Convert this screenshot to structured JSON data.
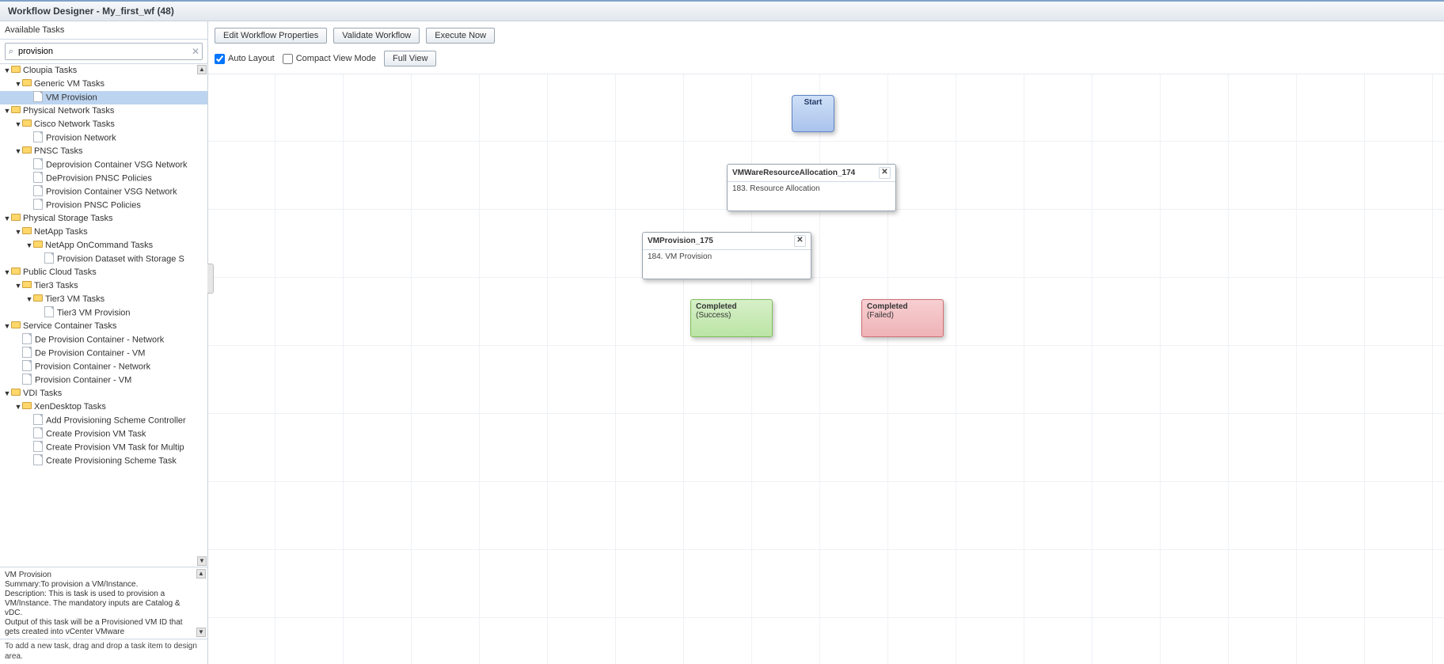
{
  "title": "Workflow Designer - My_first_wf (48)",
  "sidebar": {
    "label": "Available Tasks",
    "search_value": "provision",
    "hint": "To add a new task, drag and drop a task item to design area.",
    "info_title": "VM Provision",
    "info_summary": "Summary:To provision a VM/Instance.",
    "info_desc": "Description: This is task is used to provision a VM/Instance. The mandatory inputs are Catalog & vDC.",
    "info_out": " Output of this task will be a Provisioned VM ID that gets created into vCenter VMware",
    "tree": [
      {
        "indent": 0,
        "type": "folder",
        "label": "Cloupia Tasks"
      },
      {
        "indent": 1,
        "type": "folder",
        "label": "Generic VM Tasks"
      },
      {
        "indent": 2,
        "type": "file",
        "label": "VM Provision",
        "selected": true
      },
      {
        "indent": 0,
        "type": "folder",
        "label": "Physical Network Tasks"
      },
      {
        "indent": 1,
        "type": "folder",
        "label": "Cisco Network Tasks"
      },
      {
        "indent": 2,
        "type": "file",
        "label": "Provision Network"
      },
      {
        "indent": 1,
        "type": "folder",
        "label": "PNSC Tasks"
      },
      {
        "indent": 2,
        "type": "file",
        "label": "Deprovision Container VSG Network"
      },
      {
        "indent": 2,
        "type": "file",
        "label": "DeProvision PNSC Policies"
      },
      {
        "indent": 2,
        "type": "file",
        "label": "Provision Container VSG Network"
      },
      {
        "indent": 2,
        "type": "file",
        "label": "Provision PNSC Policies"
      },
      {
        "indent": 0,
        "type": "folder",
        "label": "Physical Storage Tasks"
      },
      {
        "indent": 1,
        "type": "folder",
        "label": "NetApp Tasks"
      },
      {
        "indent": 2,
        "type": "folder",
        "label": "NetApp OnCommand Tasks"
      },
      {
        "indent": 3,
        "type": "file",
        "label": "Provision Dataset with Storage S"
      },
      {
        "indent": 0,
        "type": "folder",
        "label": "Public Cloud Tasks"
      },
      {
        "indent": 1,
        "type": "folder",
        "label": "Tier3 Tasks"
      },
      {
        "indent": 2,
        "type": "folder",
        "label": "Tier3 VM Tasks"
      },
      {
        "indent": 3,
        "type": "file",
        "label": "Tier3 VM Provision"
      },
      {
        "indent": 0,
        "type": "folder",
        "label": "Service Container Tasks"
      },
      {
        "indent": 1,
        "type": "file",
        "label": "De Provision Container - Network"
      },
      {
        "indent": 1,
        "type": "file",
        "label": "De Provision Container - VM"
      },
      {
        "indent": 1,
        "type": "file",
        "label": "Provision Container - Network"
      },
      {
        "indent": 1,
        "type": "file",
        "label": "Provision Container - VM"
      },
      {
        "indent": 0,
        "type": "folder",
        "label": "VDI Tasks"
      },
      {
        "indent": 1,
        "type": "folder",
        "label": "XenDesktop Tasks"
      },
      {
        "indent": 2,
        "type": "file",
        "label": "Add Provisioning Scheme Controller"
      },
      {
        "indent": 2,
        "type": "file",
        "label": "Create Provision VM Task"
      },
      {
        "indent": 2,
        "type": "file",
        "label": "Create Provision VM Task for Multip"
      },
      {
        "indent": 2,
        "type": "file",
        "label": "Create Provisioning Scheme Task"
      }
    ]
  },
  "toolbar": {
    "edit": "Edit Workflow Properties",
    "validate": "Validate Workflow",
    "execute": "Execute Now",
    "auto_layout": "Auto Layout",
    "compact": "Compact View Mode",
    "fullview": "Full View"
  },
  "canvas": {
    "start": "Start",
    "node1_title": "VMWareResourceAllocation_174",
    "node1_body": "183. Resource Allocation",
    "node2_title": "VMProvision_175",
    "node2_body": "184. VM Provision",
    "success_t": "Completed",
    "success_s": "(Success)",
    "failed_t": "Completed",
    "failed_s": "(Failed)"
  }
}
